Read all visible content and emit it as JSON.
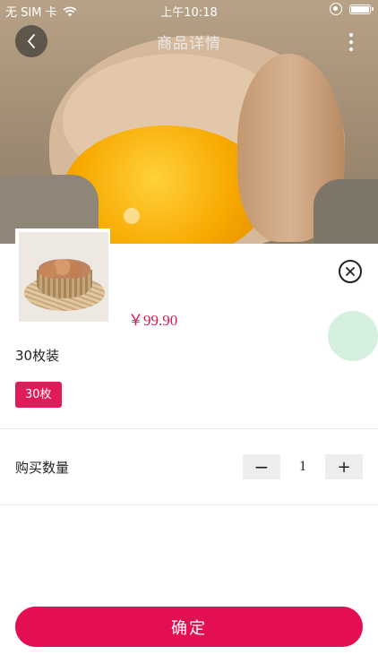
{
  "status_bar": {
    "carrier": "无 SIM 卡",
    "time": "上午10:18"
  },
  "nav": {
    "title": "商品详情"
  },
  "product": {
    "price": "￥99.90",
    "spec_title": "30枚装",
    "options": [
      "30枚"
    ],
    "selected_option": "30枚"
  },
  "quantity": {
    "label": "购买数量",
    "minus_symbol": "−",
    "plus_symbol": "+",
    "value": "1"
  },
  "actions": {
    "confirm_label": "确定"
  },
  "colors": {
    "accent": "#e30f52",
    "price": "#d81b52",
    "floating_dot": "#d6f0e0"
  },
  "icons": [
    "back-chevron-icon",
    "more-vertical-icon",
    "close-circle-icon",
    "wifi-icon",
    "orientation-lock-icon",
    "battery-icon"
  ]
}
